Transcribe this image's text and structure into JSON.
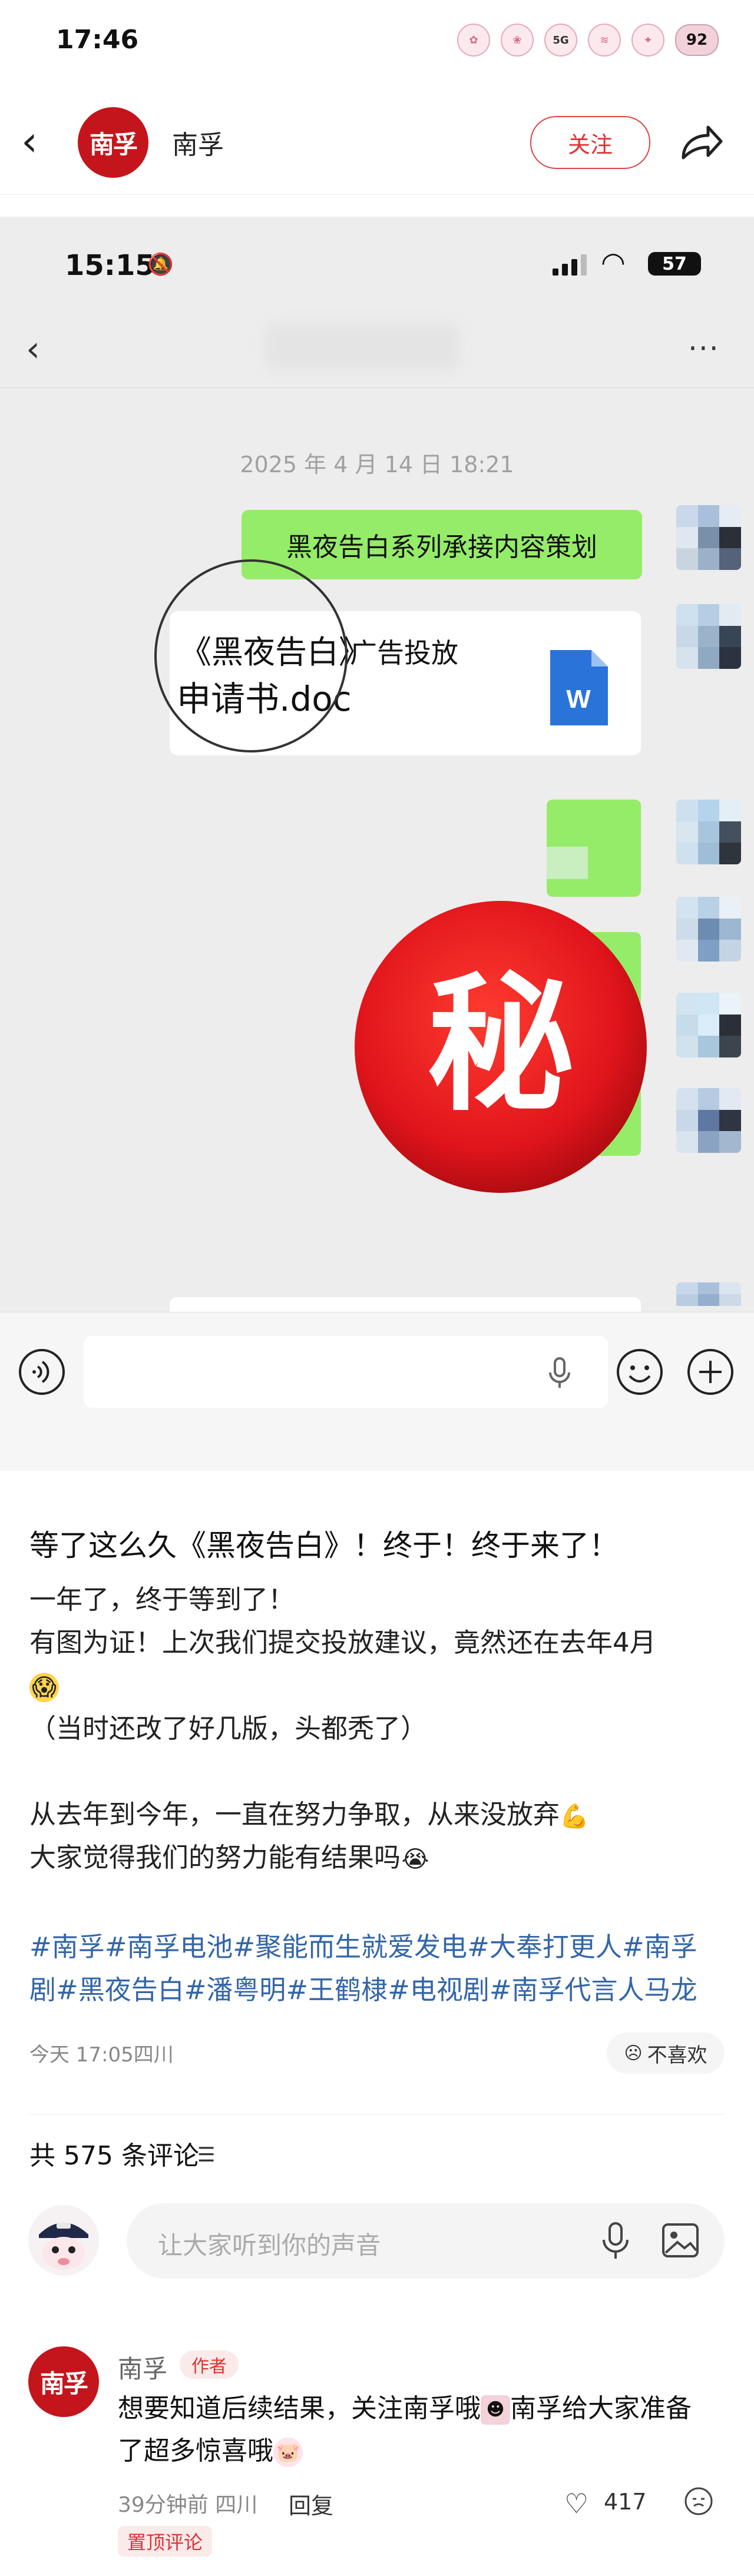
{
  "status_bar": {
    "time": "17:46",
    "network": "5G",
    "battery": "92"
  },
  "header": {
    "logo_text": "南孚",
    "name": "南孚",
    "follow_label": "关注"
  },
  "screenshot": {
    "time": "15:15",
    "battery": "57",
    "timestamp": "2025 年 4 月 14 日 18:21",
    "msg_1": "黑夜告白系列承接内容策划",
    "file_name_line1": "《黑夜告白》",
    "file_name_line1_suffix": "广告投放",
    "file_name_line2": "申请书.doc",
    "word_letter": "W",
    "stamp_text": "秘"
  },
  "post": {
    "title": "等了这么久《黑夜告白》！终于！终于来了！",
    "lines": [
      "一年了，终于等到了！",
      "有图为证！上次我们提交投放建议，竟然还在去年4月",
      "（当时还改了好几版，头都秃了）",
      "",
      "从去年到今年，一直在努力争取，从来没放弃",
      "大家觉得我们的努力能有结果吗"
    ],
    "tags_line1": "#南孚#南孚电池#聚能而生就爱发电#大奉打更人#南孚",
    "tags_line2": "剧#黑夜告白#潘粤明#王鹤棣#电视剧#南孚代言人马龙",
    "meta": "今天 17:05四川",
    "dislike_label": "不喜欢"
  },
  "comments": {
    "count_label": "共 575 条评论",
    "input_placeholder": "让大家听到你的声音",
    "items": [
      {
        "name": "南孚",
        "badge": "作者",
        "text_line1": "想要知道后续结果，关注南孚哦",
        "text_line1_b": "南孚给大家准备",
        "text_line2": "了超多惊喜哦",
        "meta": "39分钟前 四川",
        "reply_label": "回复",
        "likes": "417",
        "pinned_label": "置顶评论"
      }
    ]
  },
  "colors": {
    "brand_red": "#c4151c",
    "wechat_green": "#95ec69",
    "tag_blue": "#3366a8"
  }
}
